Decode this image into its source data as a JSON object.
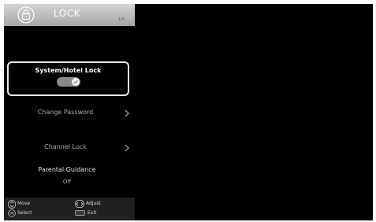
{
  "menu": {
    "title": "LOCK",
    "icon": "lock-icon",
    "page_indicator": "1/5"
  },
  "items": {
    "system_lock": {
      "label": "System/Hotel Lock",
      "state": "on",
      "focused": true
    },
    "change_password": {
      "label": "Change Password",
      "icon": "chevron-right-icon"
    },
    "channel_lock": {
      "label": "Channel Lock",
      "icon": "chevron-right-icon"
    },
    "parental_guidance": {
      "label": "Parental Guidance",
      "value": "Off"
    }
  },
  "footer": {
    "move": "Move",
    "adjust": "Adjust",
    "select": "Select",
    "exit": "Exit"
  },
  "colors": {
    "background": "#000000",
    "header": "#b8b8b8",
    "focus_border": "#e6e6e6",
    "toggle_track": "#8a8a8a",
    "footer": "#202020"
  }
}
